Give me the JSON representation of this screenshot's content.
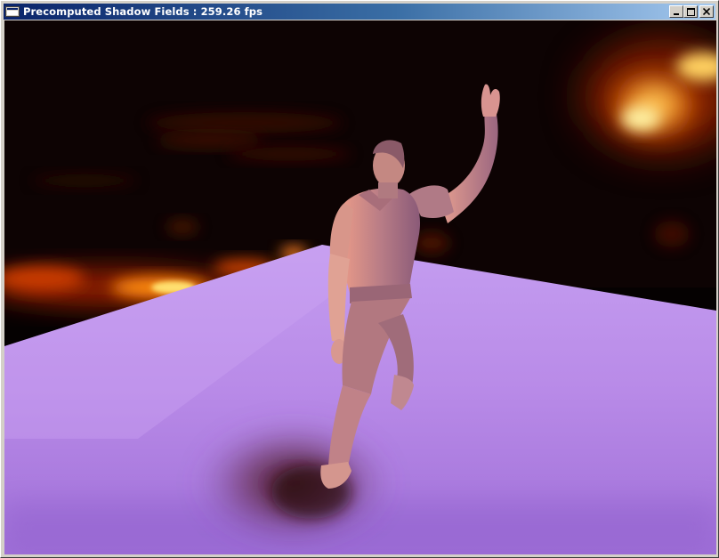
{
  "window": {
    "title": "Precomputed Shadow Fields : 259.26 fps"
  },
  "title_buttons": {
    "minimize_icon": "minimize-icon",
    "maximize_icon": "maximize-icon",
    "close_icon": "close-icon"
  },
  "scene": {
    "environment": "fiery-environment-map",
    "floor_color": "#b88ae8",
    "figure_color": "#c98a86",
    "light_color": "#ffb030"
  }
}
